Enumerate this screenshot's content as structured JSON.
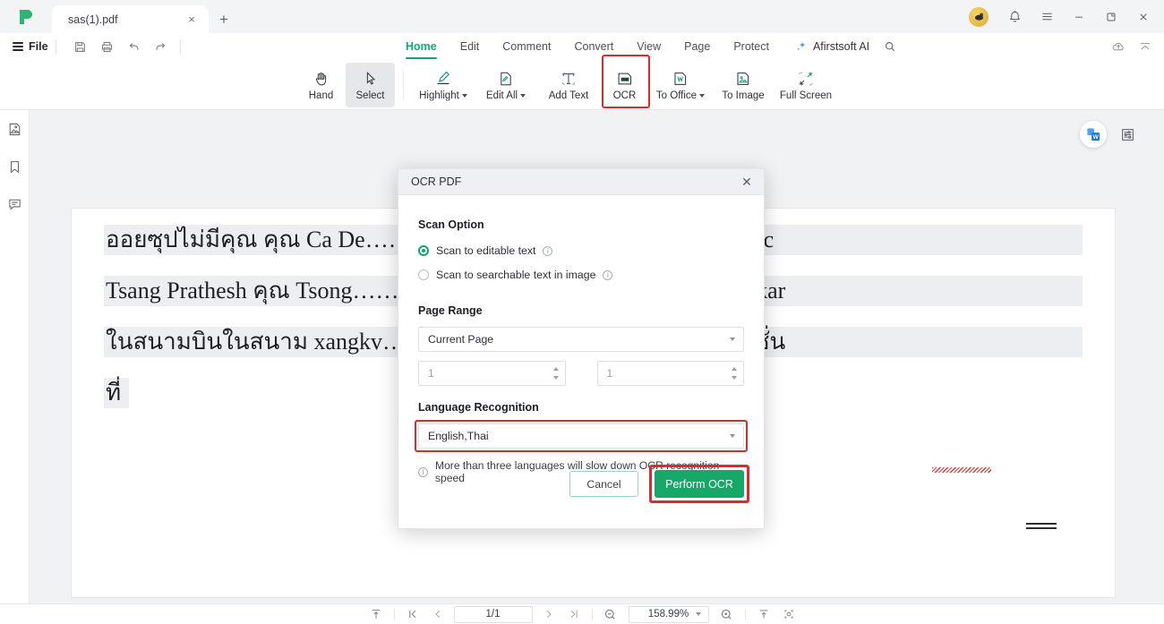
{
  "window": {
    "tab_title": "sas(1).pdf",
    "new_tab_label": "+",
    "close_tab_label": "×",
    "minimize_label": "—",
    "restore_label": "❐",
    "close_label": "×"
  },
  "quick_access": {
    "file_label": "File",
    "icons": [
      "save-icon",
      "print-icon",
      "undo-icon",
      "redo-icon"
    ]
  },
  "menu": {
    "items": [
      {
        "label": "Home",
        "active": true
      },
      {
        "label": "Edit",
        "active": false
      },
      {
        "label": "Comment",
        "active": false
      },
      {
        "label": "Convert",
        "active": false
      },
      {
        "label": "View",
        "active": false
      },
      {
        "label": "Page",
        "active": false
      },
      {
        "label": "Protect",
        "active": false
      }
    ],
    "ai_label": "Afirstsoft AI",
    "search_icon": "search-icon",
    "cloud_icon": "cloud-upload-icon",
    "collapse_icon": "collapse-ribbon-icon"
  },
  "ribbon": {
    "items": [
      {
        "label": "Hand",
        "icon": "hand-icon",
        "caret": false,
        "selected": false,
        "highlighted": false
      },
      {
        "label": "Select",
        "icon": "cursor-icon",
        "caret": false,
        "selected": true,
        "highlighted": false
      },
      {
        "label": "Highlight",
        "icon": "highlighter-icon",
        "caret": true,
        "selected": false,
        "highlighted": false
      },
      {
        "label": "Edit All",
        "icon": "edit-page-icon",
        "caret": true,
        "selected": false,
        "highlighted": false
      },
      {
        "label": "Add Text",
        "icon": "add-text-icon",
        "caret": false,
        "selected": false,
        "highlighted": false
      },
      {
        "label": "OCR",
        "icon": "ocr-icon",
        "caret": false,
        "selected": false,
        "highlighted": true
      },
      {
        "label": "To Office",
        "icon": "to-word-icon",
        "caret": true,
        "selected": false,
        "highlighted": false
      },
      {
        "label": "To Image",
        "icon": "to-image-icon",
        "caret": false,
        "selected": false,
        "highlighted": false
      },
      {
        "label": "Full Screen",
        "icon": "full-screen-icon",
        "caret": false,
        "selected": false,
        "highlighted": false
      }
    ]
  },
  "left_rail": {
    "items": [
      {
        "icon": "thumbnail-icon",
        "name": "thumbnails-panel"
      },
      {
        "icon": "bookmark-icon",
        "name": "bookmarks-panel"
      },
      {
        "icon": "comment-icon",
        "name": "comments-panel"
      }
    ]
  },
  "document": {
    "lines": [
      "ออยซุปไม่มีคุณ คุณ Ca De……………………….lim Ĥrṳ̣ tklng Turkic",
      "Tsang Prathesh คุณ Tsong………………………… mākmāy nı tlin hikar",
      "ในสนามบินในสนาม xangkv…………………….ดบริการในรถฟังค์ชั่น",
      "ที่"
    ],
    "word_badge_icon": "word-convert-icon",
    "right_panel_icon": "properties-panel-icon"
  },
  "dialog": {
    "title": "OCR PDF",
    "close_label": "✕",
    "scan_option": {
      "heading": "Scan Option",
      "options": [
        {
          "label": "Scan to editable text",
          "selected": true,
          "info": "info-icon"
        },
        {
          "label": "Scan to searchable text in image",
          "selected": false,
          "info": "info-icon"
        }
      ]
    },
    "page_range": {
      "heading": "Page Range",
      "selected": "Current Page",
      "from_value": "1",
      "to_value": "1"
    },
    "language_recognition": {
      "heading": "Language Recognition",
      "selected": "English,Thai",
      "note": "More than three languages will slow down OCR recognition speed",
      "note_icon": "info-icon"
    },
    "buttons": {
      "cancel": "Cancel",
      "perform": "Perform OCR"
    }
  },
  "statusbar": {
    "fit_icon": "fit-page-icon",
    "first_icon": "first-page-icon",
    "prev_icon": "prev-page-icon",
    "page_indicator": "1/1",
    "next_icon": "next-page-icon",
    "last_icon": "last-page-icon",
    "zoom_out_icon": "zoom-out-icon",
    "zoom_level": "158.99%",
    "zoom_in_icon": "zoom-in-icon",
    "fit_width_icon": "fit-width-icon",
    "snapshot_icon": "snapshot-icon"
  },
  "colors": {
    "accent_green": "#11a675",
    "highlight_red": "#e0292f",
    "button_green": "#16a868",
    "canvas_gray": "#f1f2f4",
    "chrome_gray": "#f3f4f6"
  }
}
